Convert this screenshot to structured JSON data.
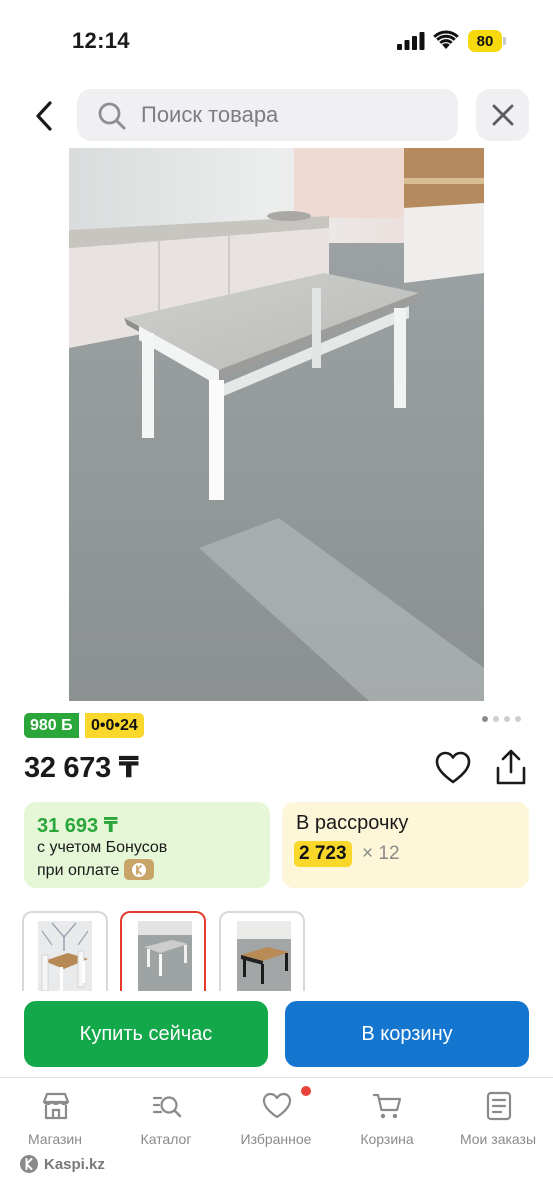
{
  "status_bar": {
    "time": "12:14",
    "battery": "80"
  },
  "header": {
    "search_placeholder": "Поиск товара",
    "icons": [
      "back-arrow-icon",
      "search-icon",
      "close-icon"
    ]
  },
  "product": {
    "carousel": {
      "total": 4,
      "active_index": 0
    },
    "bonus_badge": "980 Б",
    "installment_badge": "0•0•24",
    "price": "32 673 ₸",
    "bonus_card": {
      "price": "31 693 ₸",
      "line1": "с учетом Бонусов",
      "line2": "при оплате"
    },
    "credit_card": {
      "title": "В рассрочку",
      "amount": "2 723",
      "months": "× 12"
    },
    "thumbnails": [
      {
        "name": "thumb-table-with-chairs",
        "selected": false
      },
      {
        "name": "thumb-grey-table",
        "selected": true
      },
      {
        "name": "thumb-wood-table",
        "selected": false
      }
    ]
  },
  "actions": {
    "buy_now": "Купить сейчас",
    "add_to_cart": "В корзину"
  },
  "bottom_nav": {
    "items": [
      {
        "label": "Магазин",
        "icon": "shop-icon"
      },
      {
        "label": "Каталог",
        "icon": "catalog-icon"
      },
      {
        "label": "Избранное",
        "icon": "heart-icon"
      },
      {
        "label": "Корзина",
        "icon": "cart-icon"
      },
      {
        "label": "Мои заказы",
        "icon": "orders-icon"
      }
    ]
  },
  "watermark": "Kaspi.kz",
  "colors": {
    "green": "#13a84a",
    "blue": "#1576d0",
    "yellow": "#f9d72b",
    "red": "#e43a2e"
  }
}
